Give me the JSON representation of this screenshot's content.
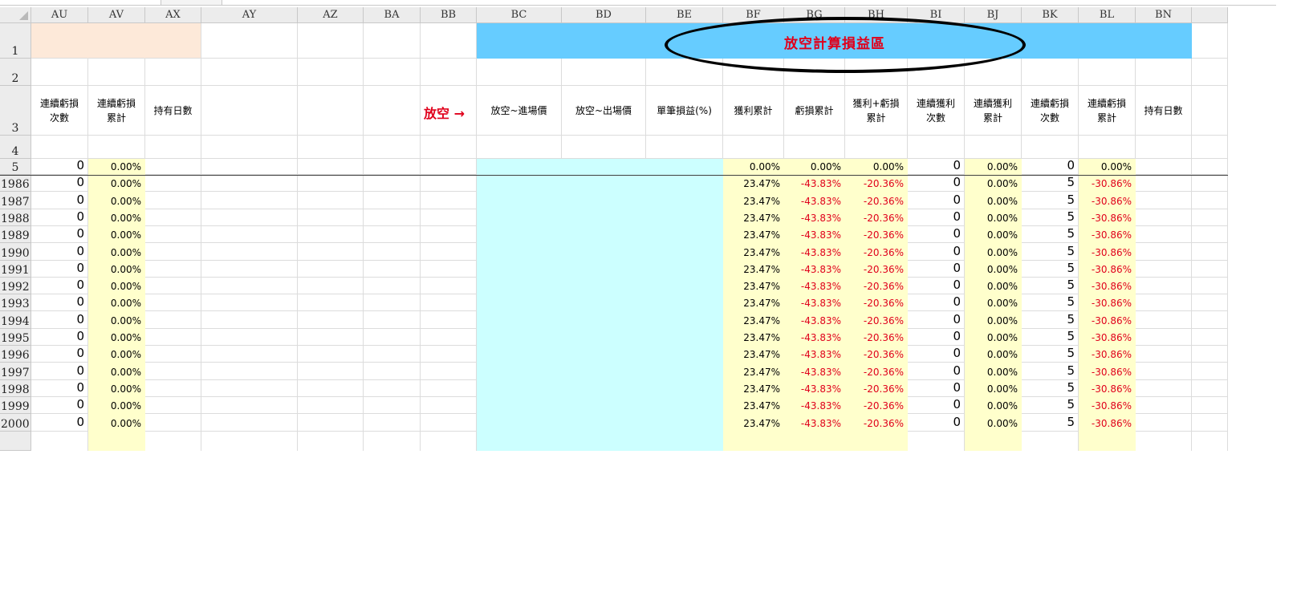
{
  "columns": [
    {
      "id": "au",
      "label": "AU"
    },
    {
      "id": "av",
      "label": "AV"
    },
    {
      "id": "ax",
      "label": "AX"
    },
    {
      "id": "ay",
      "label": "AY"
    },
    {
      "id": "az",
      "label": "AZ"
    },
    {
      "id": "ba",
      "label": "BA"
    },
    {
      "id": "bb",
      "label": "BB"
    },
    {
      "id": "bc",
      "label": "BC"
    },
    {
      "id": "bd",
      "label": "BD"
    },
    {
      "id": "be",
      "label": "BE"
    },
    {
      "id": "bf",
      "label": "BF"
    },
    {
      "id": "bg",
      "label": "BG"
    },
    {
      "id": "bh",
      "label": "BH"
    },
    {
      "id": "bi",
      "label": "BI"
    },
    {
      "id": "bj",
      "label": "BJ"
    },
    {
      "id": "bk",
      "label": "BK"
    },
    {
      "id": "bl",
      "label": "BL"
    },
    {
      "id": "bn",
      "label": "BN"
    }
  ],
  "row_labels": {
    "r1": "1",
    "r2": "2",
    "r3": "3",
    "r4": "4",
    "r5": "5"
  },
  "title": "放空計算損益區",
  "short_marker": "放空 →",
  "headers": {
    "au": "連續虧損\n次數",
    "av": "連續虧損\n累計",
    "ax": "持有日數",
    "bc": "放空~進場價",
    "bd": "放空~出場價",
    "be": "單筆損益(%)",
    "bf": "獲利累計",
    "bg": "虧損累計",
    "bh": "獲利+虧損\n累計",
    "bi": "連續獲利\n次數",
    "bj": "連續獲利\n累計",
    "bk": "連續虧損\n次數",
    "bl": "連續虧損\n累計",
    "bn": "持有日數"
  },
  "row5": {
    "au": "0",
    "av": "0.00%",
    "bf": "0.00%",
    "bg": "0.00%",
    "bh": "0.00%",
    "bi": "0",
    "bj": "0.00%",
    "bk": "0",
    "bl": "0.00%"
  },
  "data_rows": [
    {
      "row": "1986",
      "au": "0",
      "av": "0.00%",
      "bf": "23.47%",
      "bg": "-43.83%",
      "bh": "-20.36%",
      "bi": "0",
      "bj": "0.00%",
      "bk": "5",
      "bl": "-30.86%"
    },
    {
      "row": "1987",
      "au": "0",
      "av": "0.00%",
      "bf": "23.47%",
      "bg": "-43.83%",
      "bh": "-20.36%",
      "bi": "0",
      "bj": "0.00%",
      "bk": "5",
      "bl": "-30.86%"
    },
    {
      "row": "1988",
      "au": "0",
      "av": "0.00%",
      "bf": "23.47%",
      "bg": "-43.83%",
      "bh": "-20.36%",
      "bi": "0",
      "bj": "0.00%",
      "bk": "5",
      "bl": "-30.86%"
    },
    {
      "row": "1989",
      "au": "0",
      "av": "0.00%",
      "bf": "23.47%",
      "bg": "-43.83%",
      "bh": "-20.36%",
      "bi": "0",
      "bj": "0.00%",
      "bk": "5",
      "bl": "-30.86%"
    },
    {
      "row": "1990",
      "au": "0",
      "av": "0.00%",
      "bf": "23.47%",
      "bg": "-43.83%",
      "bh": "-20.36%",
      "bi": "0",
      "bj": "0.00%",
      "bk": "5",
      "bl": "-30.86%"
    },
    {
      "row": "1991",
      "au": "0",
      "av": "0.00%",
      "bf": "23.47%",
      "bg": "-43.83%",
      "bh": "-20.36%",
      "bi": "0",
      "bj": "0.00%",
      "bk": "5",
      "bl": "-30.86%"
    },
    {
      "row": "1992",
      "au": "0",
      "av": "0.00%",
      "bf": "23.47%",
      "bg": "-43.83%",
      "bh": "-20.36%",
      "bi": "0",
      "bj": "0.00%",
      "bk": "5",
      "bl": "-30.86%"
    },
    {
      "row": "1993",
      "au": "0",
      "av": "0.00%",
      "bf": "23.47%",
      "bg": "-43.83%",
      "bh": "-20.36%",
      "bi": "0",
      "bj": "0.00%",
      "bk": "5",
      "bl": "-30.86%"
    },
    {
      "row": "1994",
      "au": "0",
      "av": "0.00%",
      "bf": "23.47%",
      "bg": "-43.83%",
      "bh": "-20.36%",
      "bi": "0",
      "bj": "0.00%",
      "bk": "5",
      "bl": "-30.86%"
    },
    {
      "row": "1995",
      "au": "0",
      "av": "0.00%",
      "bf": "23.47%",
      "bg": "-43.83%",
      "bh": "-20.36%",
      "bi": "0",
      "bj": "0.00%",
      "bk": "5",
      "bl": "-30.86%"
    },
    {
      "row": "1996",
      "au": "0",
      "av": "0.00%",
      "bf": "23.47%",
      "bg": "-43.83%",
      "bh": "-20.36%",
      "bi": "0",
      "bj": "0.00%",
      "bk": "5",
      "bl": "-30.86%"
    },
    {
      "row": "1997",
      "au": "0",
      "av": "0.00%",
      "bf": "23.47%",
      "bg": "-43.83%",
      "bh": "-20.36%",
      "bi": "0",
      "bj": "0.00%",
      "bk": "5",
      "bl": "-30.86%"
    },
    {
      "row": "1998",
      "au": "0",
      "av": "0.00%",
      "bf": "23.47%",
      "bg": "-43.83%",
      "bh": "-20.36%",
      "bi": "0",
      "bj": "0.00%",
      "bk": "5",
      "bl": "-30.86%"
    },
    {
      "row": "1999",
      "au": "0",
      "av": "0.00%",
      "bf": "23.47%",
      "bg": "-43.83%",
      "bh": "-20.36%",
      "bi": "0",
      "bj": "0.00%",
      "bk": "5",
      "bl": "-30.86%"
    },
    {
      "row": "2000",
      "au": "0",
      "av": "0.00%",
      "bf": "23.47%",
      "bg": "-43.83%",
      "bh": "-20.36%",
      "bi": "0",
      "bj": "0.00%",
      "bk": "5",
      "bl": "-30.86%"
    }
  ],
  "colors": {
    "banner": "#66ccff",
    "negative": "#e0001b",
    "yellow_fill": "#ffffcc",
    "cyan_fill": "#ccffff",
    "peach_fill": "#fde9d9"
  }
}
